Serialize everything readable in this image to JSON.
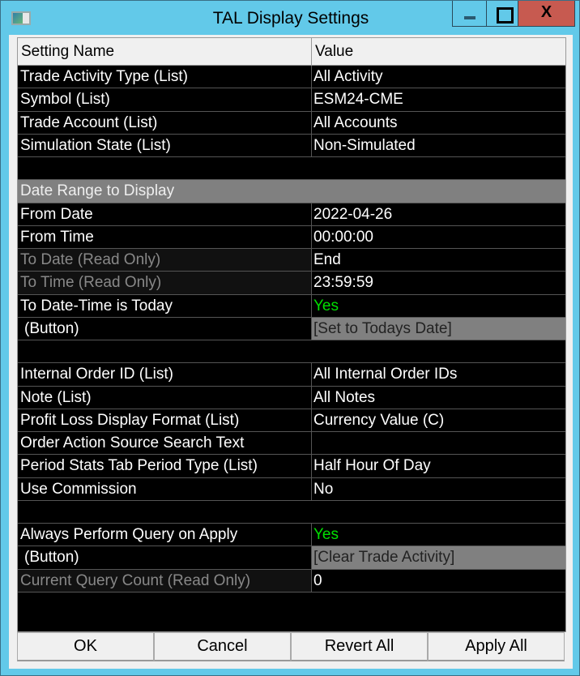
{
  "window": {
    "title": "TAL Display Settings",
    "close_glyph": "X"
  },
  "table": {
    "headers": [
      "Setting Name",
      "Value"
    ],
    "rows": [
      {
        "name": "Trade Activity Type (List)",
        "value": "All Activity"
      },
      {
        "name": "Symbol (List)",
        "value": "ESM24-CME"
      },
      {
        "name": "Trade Account (List)",
        "value": "All Accounts"
      },
      {
        "name": "Simulation State (List)",
        "value": "Non-Simulated"
      },
      {
        "type": "empty"
      },
      {
        "type": "section",
        "name": "Date Range to Display"
      },
      {
        "name": "From Date",
        "value": "2022-04-26"
      },
      {
        "name": "From Time",
        "value": "00:00:00"
      },
      {
        "name": "To Date (Read Only)",
        "value": "End",
        "type": "ro"
      },
      {
        "name": "To Time (Read Only)",
        "value": "23:59:59",
        "type": "ro"
      },
      {
        "name": "To Date-Time is Today",
        "value": "Yes",
        "green": true
      },
      {
        "name": "(Button)",
        "value": "[Set to Todays Date]",
        "type": "btn"
      },
      {
        "type": "empty"
      },
      {
        "name": "Internal Order ID (List)",
        "value": "All Internal Order IDs"
      },
      {
        "name": "Note (List)",
        "value": "All Notes"
      },
      {
        "name": "Profit Loss Display Format (List)",
        "value": "Currency Value (C)"
      },
      {
        "name": "Order Action Source Search Text",
        "value": ""
      },
      {
        "name": "Period Stats Tab Period Type (List)",
        "value": "Half Hour Of Day"
      },
      {
        "name": "Use Commission",
        "value": "No"
      },
      {
        "type": "empty"
      },
      {
        "name": "Always Perform Query on Apply",
        "value": "Yes",
        "green": true
      },
      {
        "name": "(Button)",
        "value": "[Clear Trade Activity]",
        "type": "btn"
      },
      {
        "name": "Current Query Count (Read Only)",
        "value": "0",
        "type": "ro"
      }
    ]
  },
  "buttons": {
    "ok": "OK",
    "cancel": "Cancel",
    "revert": "Revert All",
    "apply": "Apply All"
  },
  "colors": {
    "titlebar": "#62c9e9",
    "close": "#c75a50",
    "yes": "#00e000",
    "section": "#808080"
  }
}
